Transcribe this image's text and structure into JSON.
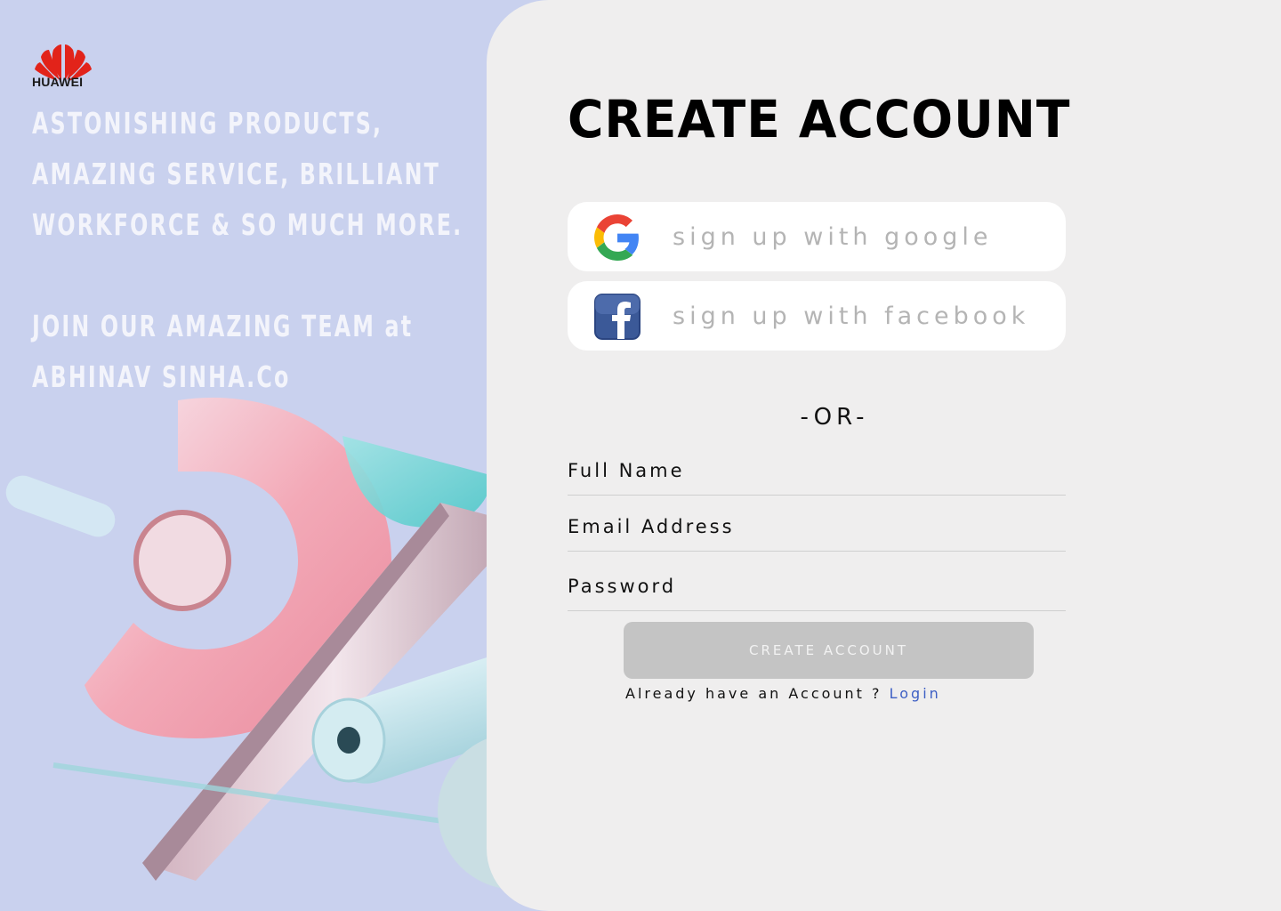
{
  "brand": {
    "name": "HUAWEI",
    "color": "#e2231a"
  },
  "tagline": "ASTONISHING PRODUCTS,\nAMAZING SERVICE, BRILLIANT\nWORKFORCE & SO MUCH MORE.",
  "join": {
    "line1": "JOIN OUR AMAZING TEAM at",
    "line2": "ABHINAV SINHA.Co"
  },
  "form": {
    "title": "CREATE ACCOUNT",
    "google_label": "sign up with google",
    "facebook_label": "sign up with facebook",
    "or_text": "-OR-",
    "full_name_placeholder": "Full Name",
    "email_placeholder": "Email Address",
    "password_placeholder": "Password",
    "submit_label": "CREATE ACCOUNT",
    "already_text": "Already have an Account ?",
    "login_label": "Login"
  },
  "colors": {
    "left_bg": "#c9d1ee",
    "right_bg": "#efeeee",
    "login_link": "#3d5fc4"
  }
}
